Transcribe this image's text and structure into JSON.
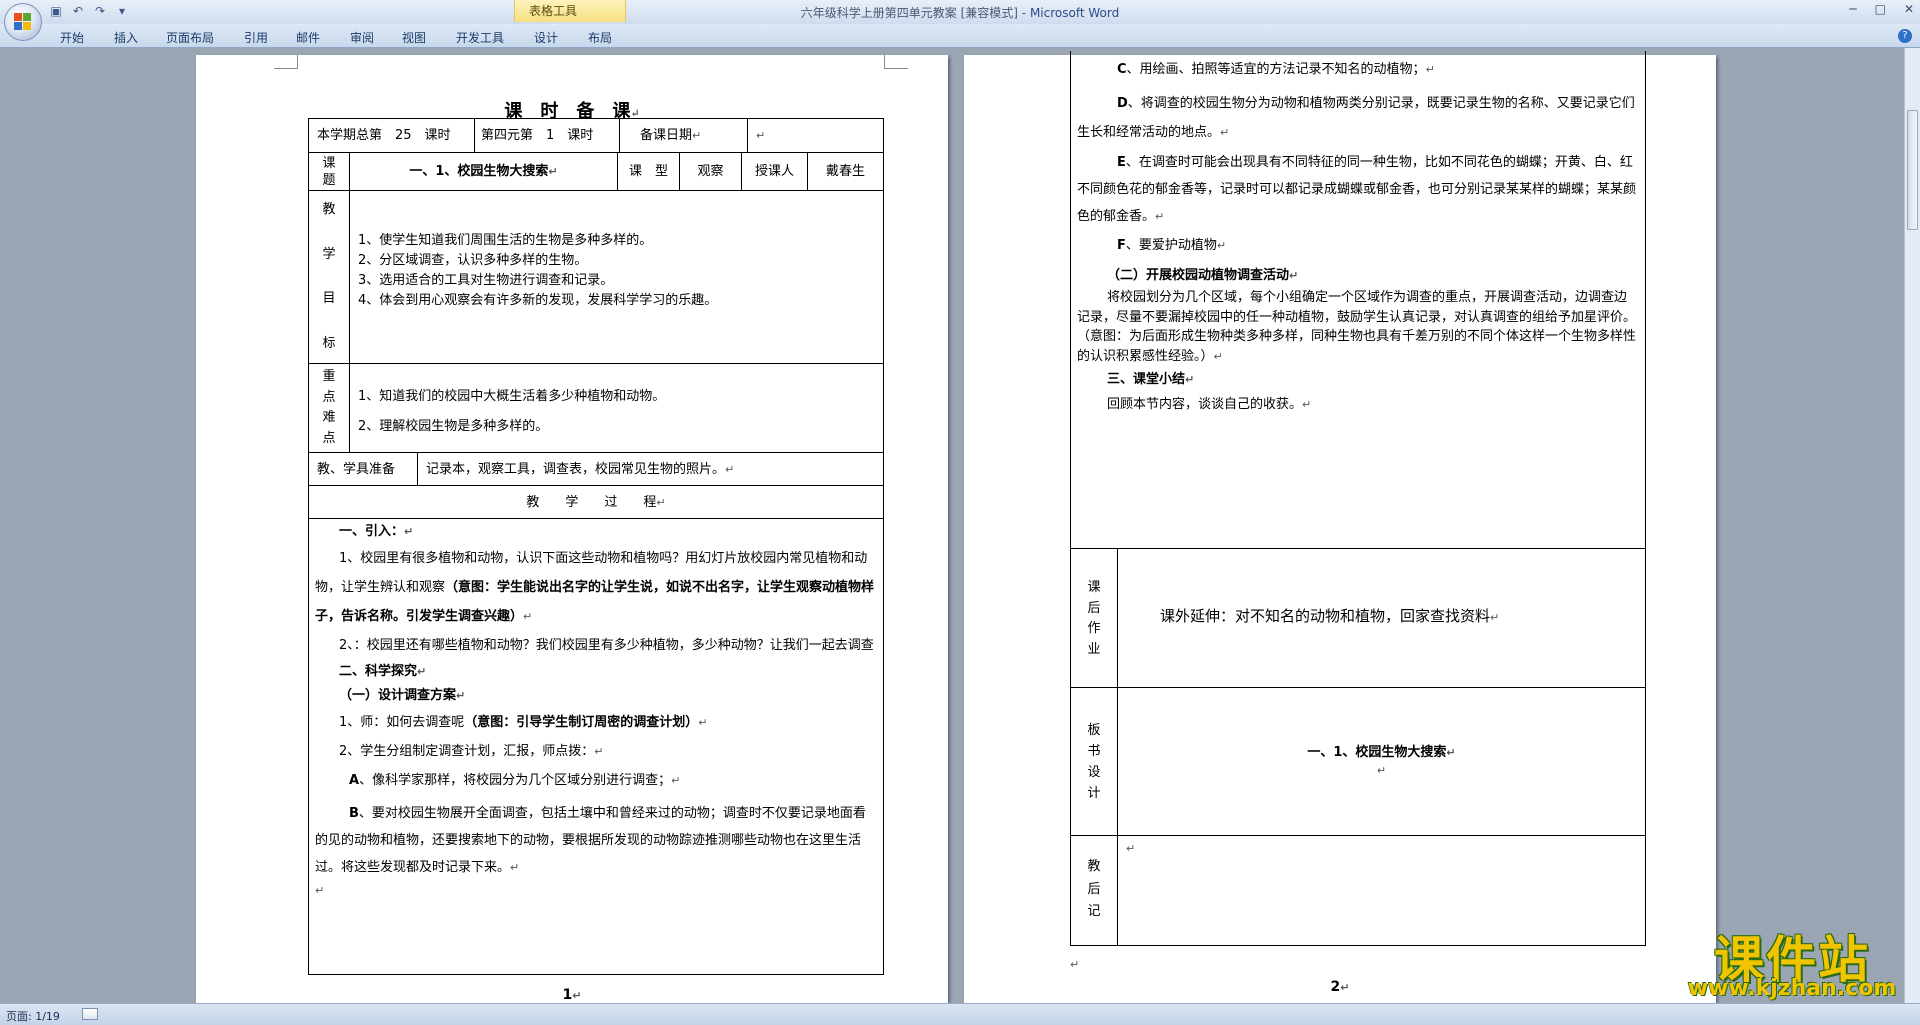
{
  "window": {
    "title": "六年级科学上册第四单元教案 [兼容模式]",
    "title_sep": " - ",
    "app_name": "Microsoft Word",
    "contextual_tab": "表格工具"
  },
  "qat": {
    "save": "▣",
    "undo": "↶",
    "redo": "↷",
    "customize": "▾"
  },
  "winctl": {
    "minimize": "─",
    "maximize": "□",
    "close": "✕"
  },
  "ribbon": {
    "tabs": [
      "开始",
      "插入",
      "页面布局",
      "引用",
      "邮件",
      "审阅",
      "视图",
      "开发工具",
      "设计",
      "布局"
    ],
    "help": "?"
  },
  "mark": "↵",
  "page1": {
    "title": "课　时　备　课",
    "header_row": {
      "c1": "本学期总第　25　课时",
      "c2": "第四元第　1　课时",
      "c3": "备课日期"
    },
    "topic_row": {
      "label1": "课",
      "label2": "题",
      "topic": "一、1、校园生物大搜索",
      "type_label": "课　型",
      "type_value": "观察",
      "teacher_label": "授课人",
      "teacher_name": "戴春生"
    },
    "goals": {
      "label": [
        "教",
        "学",
        "目",
        "标"
      ],
      "items": [
        "1、使学生知道我们周围生活的生物是多种多样的。",
        "2、分区域调查，认识多种多样的生物。",
        "3、选用适合的工具对生物进行调查和记录。",
        "4、体会到用心观察会有许多新的发现，发展科学学习的乐趣。"
      ]
    },
    "keypoints": {
      "label": [
        "重",
        "点",
        "难",
        "点"
      ],
      "items": [
        "1、知道我们的校园中大概生活着多少种植物和动物。",
        "2、理解校园生物是多种多样的。"
      ]
    },
    "materials": {
      "label": "教、学具准备",
      "value": "记录本，观察工具，调查表，校园常见生物的照片。"
    },
    "process_label": "教　　学　　过　　程",
    "process": {
      "intro_h": "一、引入：",
      "p1": "1、校园里有很多植物和动物，认识下面这些动物和植物吗？用幻灯片放校园内常见植物和动物，让学生辨认和观察",
      "p1_bold": "（意图：学生能说出名字的让学生说，如说不出名字，让学生观察动植物样子，告诉名称。引发学生调查兴趣）",
      "p2": "2、：校园里还有哪些植物和动物？我们校园里有多少种植物，多少种动物？让我们一起去调查",
      "explore_h": "二、科学探究",
      "sub1_h": "（一）设计调查方案",
      "q1": "1、师：如何去调查呢",
      "q1_bold": "（意图：引导学生制订周密的调查计划）",
      "q2": "2、学生分组制定调查计划，汇报，师点拨：",
      "A_label": "A",
      "A_text": "、像科学家那样，将校园分为几个区域分别进行调查；",
      "B_label": "B",
      "B_text": "、要对校园生物展开全面调查，包括土壤中和曾经来过的动物；调查时不仅要记录地面看的见的动物和植物，还要搜索地下的动物，要根据所发现的动物踪迹推测哪些动物也在这里生活过。将这些发现都及时记录下来。"
    },
    "page_num": "1"
  },
  "page2": {
    "C_label": "C",
    "C_text": "、用绘画、拍照等适宜的方法记录不知名的动植物；",
    "D_label": "D",
    "D_text": "、将调查的校园生物分为动物和植物两类分别记录，既要记录生物的名称、又要记录它们生长和经常活动的地点。",
    "E_label": "E",
    "E_text": "、在调查时可能会出现具有不同特征的同一种生物，比如不同花色的蝴蝶；开黄、白、红不同颜色花的郁金香等，记录时可以都记录成蝴蝶或郁金香，也可分别记录某某样的蝴蝶；某某颜色的郁金香。",
    "F_label": "F",
    "F_text": "、要爱护动植物",
    "sub2_h": "（二）开展校园动植物调查活动",
    "sub2_p": "将校园划分为几个区域，每个小组确定一个区域作为调查的重点，开展调查活动，边调查边记录，尽量不要漏掉校园中的任一种动植物，鼓励学生认真记录，对认真调查的组给予加星评价。（意图：为后面形成生物种类多种多样，同种生物也具有千差万别的不同个体这样一个生物多样性的认识积累感性经验。）",
    "summary_h": "三、课堂小结",
    "summary_p": "回顾本节内容，谈谈自己的收获。",
    "homework_label": [
      "课",
      "后",
      "作",
      "业"
    ],
    "homework": "课外延伸：对不知名的动物和植物，回家查找资料",
    "board_label": [
      "板",
      "书",
      "设",
      "计"
    ],
    "board": "一、1、校园生物大搜索",
    "reflection_label": [
      "教",
      "后",
      "记"
    ],
    "page_num": "2"
  },
  "status": {
    "page": "页面: 1/19"
  },
  "watermark": {
    "main": "课件站",
    "url": "www.kjzhan.com"
  }
}
